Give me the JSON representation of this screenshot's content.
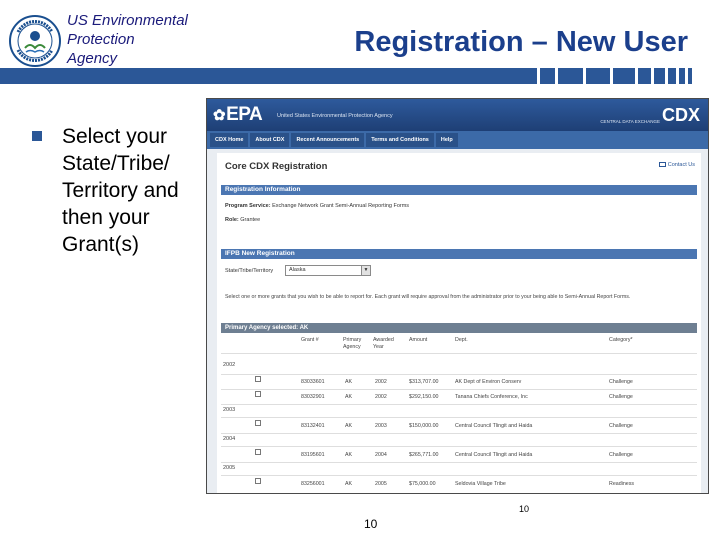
{
  "colors": {
    "title_blue": "#1b3f8c",
    "bar_blue": "#2b5797",
    "agency_text": "#1a1a7a",
    "epa_header": "#2e5a9c",
    "section_bar": "#4b76b2",
    "grant_bar": "#6e7f92"
  },
  "header": {
    "agency_lines": [
      "US Environmental",
      "Protection",
      "Agency"
    ],
    "title": "Registration – New User",
    "seal_icon": "epa-seal-icon"
  },
  "bullet": {
    "icon": "square-bullet-icon",
    "lines": [
      "Select your",
      "State/Tribe/",
      "Territory and",
      "then your",
      "Grant(s)"
    ]
  },
  "screenshot": {
    "epa_logo": "EPA",
    "epa_subtitle": "United States Environmental Protection Agency",
    "cdx_tagline": "CENTRAL DATA EXCHANGE",
    "cdx_logo": "CDX",
    "nav": [
      "CDX Home",
      "About CDX",
      "Recent Announcements",
      "Terms and Conditions",
      "Help"
    ],
    "page_title": "Core CDX Registration",
    "contact": "Contact Us",
    "registration_info": {
      "header": "Registration Information",
      "program_label": "Program Service:",
      "program_value": "Exchange Network Grant Semi-Annual Reporting Forms",
      "role_label": "Role:",
      "role_value": "Grantee"
    },
    "new_registration": {
      "header": "IFPB New Registration",
      "state_label": "State/Tribe/Territory",
      "state_value": "Alaska",
      "instructions": "Select one or more grants that you wish to be able to report for. Each grant will require approval from the administrator prior to your being able to Semi-Annual Report Forms."
    },
    "grant_table": {
      "header": "Primary Agency selected: AK",
      "columns": [
        "Grant #",
        "Primary Agency",
        "Awarded Year",
        "Amount",
        "Dept.",
        "Category*"
      ],
      "groups": [
        {
          "year": "2002",
          "rows": [
            {
              "grant": "83033601",
              "agency": "AK",
              "awarded": "2002",
              "amount": "$313,707.00",
              "dept": "AK Dept of Environ Conserv",
              "category": "Challenge"
            },
            {
              "grant": "83032901",
              "agency": "AK",
              "awarded": "2002",
              "amount": "$292,150.00",
              "dept": "Tanana Chiefs Conference, Inc",
              "category": "Challenge"
            }
          ]
        },
        {
          "year": "2003",
          "rows": [
            {
              "grant": "83132401",
              "agency": "AK",
              "awarded": "2003",
              "amount": "$150,000.00",
              "dept": "Central Council Tlingit and Haida",
              "category": "Challenge"
            }
          ]
        },
        {
          "year": "2004",
          "rows": [
            {
              "grant": "83195601",
              "agency": "AK",
              "awarded": "2004",
              "amount": "$265,771.00",
              "dept": "Central Council Tlingit and Haida",
              "category": "Challenge"
            }
          ]
        },
        {
          "year": "2005",
          "rows": [
            {
              "grant": "83256001",
              "agency": "AK",
              "awarded": "2005",
              "amount": "$75,000.00",
              "dept": "Seldovia Village Tribe",
              "category": "Readiness"
            }
          ]
        }
      ]
    }
  },
  "footer": {
    "tiny_number": "10",
    "page_number": "10"
  }
}
